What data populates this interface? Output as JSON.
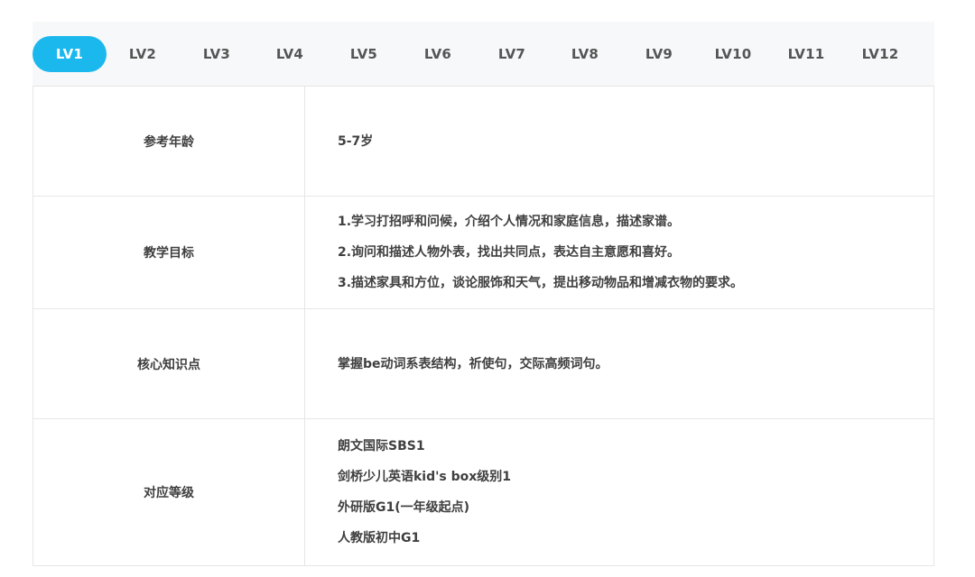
{
  "tabs": [
    {
      "label": "LV1",
      "active": true
    },
    {
      "label": "LV2",
      "active": false
    },
    {
      "label": "LV3",
      "active": false
    },
    {
      "label": "LV4",
      "active": false
    },
    {
      "label": "LV5",
      "active": false
    },
    {
      "label": "LV6",
      "active": false
    },
    {
      "label": "LV7",
      "active": false
    },
    {
      "label": "LV8",
      "active": false
    },
    {
      "label": "LV9",
      "active": false
    },
    {
      "label": "LV10",
      "active": false
    },
    {
      "label": "LV11",
      "active": false
    },
    {
      "label": "LV12",
      "active": false
    }
  ],
  "colors": {
    "accent": "#1bb8ee",
    "tab_bar_bg": "#f7f8f9",
    "border": "#e6e6e6"
  },
  "rows": [
    {
      "label": "参考年龄",
      "lines": [
        "5-7岁"
      ]
    },
    {
      "label": "教学目标",
      "lines": [
        "1.学习打招呼和问候，介绍个人情况和家庭信息，描述家谱。",
        "2.询问和描述人物外表，找出共同点，表达自主意愿和喜好。",
        "3.描述家具和方位，谈论服饰和天气，提出移动物品和增减衣物的要求。"
      ]
    },
    {
      "label": "核心知识点",
      "lines": [
        "掌握be动词系表结构，祈使句，交际高频词句。"
      ]
    },
    {
      "label": "对应等级",
      "lines": [
        "朗文国际SBS1",
        "剑桥少儿英语kid's box级别1",
        "外研版G1(一年级起点)",
        "人教版初中G1"
      ]
    }
  ]
}
